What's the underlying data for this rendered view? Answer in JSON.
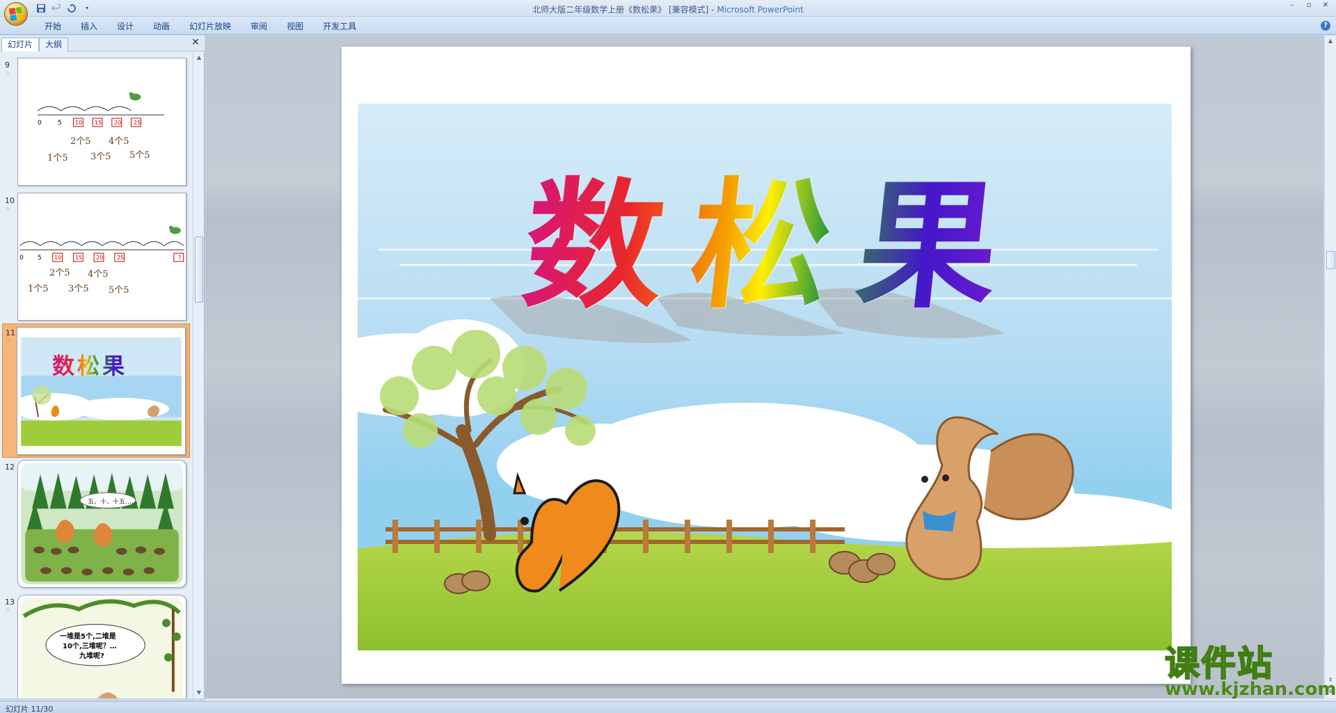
{
  "window": {
    "title_doc": "北师大版二年级数学上册《数松果》 [兼容模式] - ",
    "title_app": "Microsoft PowerPoint",
    "controls": [
      "–",
      "▫",
      "✕"
    ]
  },
  "quick_access": [
    "save-icon",
    "undo-icon",
    "redo-icon",
    "customize-icon"
  ],
  "ribbon": {
    "tabs": [
      "开始",
      "插入",
      "设计",
      "动画",
      "幻灯片放映",
      "审阅",
      "视图",
      "开发工具"
    ]
  },
  "left_pane": {
    "tabs": [
      "幻灯片",
      "大纲"
    ],
    "close": "✕",
    "thumbnails": [
      {
        "num": "9"
      },
      {
        "num": "10"
      },
      {
        "num": "11",
        "selected": true
      },
      {
        "num": "12"
      },
      {
        "num": "13"
      }
    ],
    "thumb9": {
      "ticks": [
        "0",
        "5",
        "10",
        "15",
        "20",
        "25"
      ],
      "groups": [
        "2个5",
        "4个5",
        "1个5",
        "3个5",
        "5个5"
      ]
    },
    "thumb10": {
      "ticks": [
        "0",
        "5",
        "10",
        "15",
        "20",
        "25",
        "?"
      ],
      "groups": [
        "2个5",
        "4个5",
        "1个5",
        "3个5",
        "5个5"
      ]
    },
    "thumb11": {
      "title": "数松果"
    },
    "thumb12": {
      "bubble": "五、十、十五……"
    },
    "thumb13": {
      "bubble_l1": "一堆是5个,二堆是",
      "bubble_l2": "10个,三堆呢？…",
      "bubble_l3": "九堆呢?"
    }
  },
  "slide": {
    "title": "数松果",
    "title_colors": [
      "#d6167a",
      "#f0b300",
      "#2f9a3a",
      "#4417c9"
    ]
  },
  "status": {
    "text": "幻灯片 11/30"
  },
  "watermark": {
    "main": "课件站",
    "url": "www.kjzhan.com"
  }
}
